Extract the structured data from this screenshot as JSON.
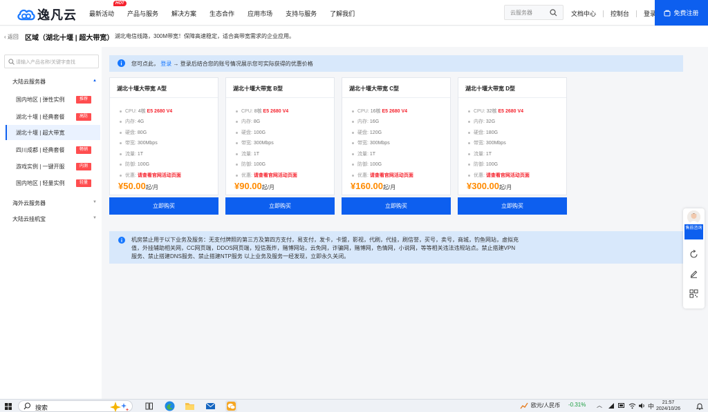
{
  "header": {
    "logo_text": "逸凡云",
    "nav": [
      {
        "label": "最新活动",
        "hot": "HOT"
      },
      {
        "label": "产品与服务"
      },
      {
        "label": "解决方案"
      },
      {
        "label": "生态合作"
      },
      {
        "label": "应用市场"
      },
      {
        "label": "支持与服务"
      },
      {
        "label": "了解我们"
      }
    ],
    "search_placeholder": "云服务器",
    "links": [
      "文档中心",
      "控制台",
      "登录"
    ],
    "register": "免费注册"
  },
  "crumb": {
    "back": "返回",
    "region": "区域（湖北十堰 | 超大带宽）",
    "desc": "湖北电信线路，300M带宽！保障高速稳定，适合高带宽需求的企业应用。"
  },
  "sidebar": {
    "search_placeholder": "请输入产品名称/关键字查找",
    "groups": [
      {
        "label": "大陆云服务器",
        "expanded": true
      },
      {
        "label": "海外云服务器",
        "expanded": false
      },
      {
        "label": "大陆云挂机宝",
        "expanded": false
      }
    ],
    "items": [
      {
        "label": "国内地区 | 弹性实例",
        "badge": "推荐"
      },
      {
        "label": "湖北十堰 | 经典套餐",
        "badge": "高防"
      },
      {
        "label": "湖北十堰 | 超大带宽",
        "badge": "",
        "active": true
      },
      {
        "label": "四川成都 | 经典套餐",
        "badge": "畅销"
      },
      {
        "label": "游戏实例 | 一键开服",
        "badge": "内测"
      },
      {
        "label": "国内地区 | 轻量实例",
        "badge": "轻量"
      }
    ]
  },
  "notice_top": {
    "prefix": "您可点此，",
    "link": "登录",
    "suffix": "→ 登录后结合您的账号情况展示您可实际获得的优惠价格"
  },
  "spec_labels": {
    "cpu": "CPU:",
    "mem": "内存:",
    "disk": "硬盘:",
    "bw": "带宽:",
    "traffic": "流量:",
    "ddos": "防御:",
    "promo": "优惠:"
  },
  "cards": [
    {
      "title": "湖北十堰大带宽 A型",
      "cpu_core": "4核",
      "cpu_model": "E5 2680 V4",
      "mem": "4G",
      "disk": "80G",
      "bw": "300Mbps",
      "traffic": "1T",
      "ddos": "100G",
      "promo": "请查看官网活动页面",
      "price": "¥50.00",
      "unit": "起/月",
      "buy": "立即购买"
    },
    {
      "title": "湖北十堰大带宽 B型",
      "cpu_core": "8核",
      "cpu_model": "E5 2680 V4",
      "mem": "8G",
      "disk": "100G",
      "bw": "300Mbps",
      "traffic": "1T",
      "ddos": "100G",
      "promo": "请查看官网活动页面",
      "price": "¥90.00",
      "unit": "起/月",
      "buy": "立即购买"
    },
    {
      "title": "湖北十堰大带宽 C型",
      "cpu_core": "16核",
      "cpu_model": "E5 2680 V4",
      "mem": "16G",
      "disk": "120G",
      "bw": "300Mbps",
      "traffic": "1T",
      "ddos": "100G",
      "promo": "请查看官网活动页面",
      "price": "¥160.00",
      "unit": "起/月",
      "buy": "立即购买"
    },
    {
      "title": "湖北十堰大带宽 D型",
      "cpu_core": "32核",
      "cpu_model": "E5 2680 V4",
      "mem": "32G",
      "disk": "180G",
      "bw": "300Mbps",
      "traffic": "1T",
      "ddos": "100G",
      "promo": "请查看官网活动页面",
      "price": "¥300.00",
      "unit": "起/月",
      "buy": "立即购买"
    }
  ],
  "notice_bottom": "机房禁止用于以下业务及服务：无支付牌照的第三方及第四方支付，易支付，发卡，卡盟，影视，代刷，代挂，刷信誉，买号，卖号，商城，钓鱼网站，虚拟充值，外挂辅助相关网，CC网页端，DDOS网页端，短信轰炸，赌博网站，云免网，诈骗网，赌博网，色情网，小说网，等等相关违法违规站点。禁止搭建VPN服务、禁止搭建DNS服务、禁止搭建NTP服务 以上业务及服务一经发现，立即永久关闭。",
  "float_panel": {
    "consult": "售前咨询"
  },
  "taskbar": {
    "search": "搜索",
    "currency": "欧元/人民币",
    "change": "-0.31%",
    "ime": "中",
    "time": "21:57",
    "date": "2024/10/26"
  },
  "colors": {
    "primary": "#0d5fef",
    "price": "#ff8a00",
    "badge": "#ff4d4f",
    "notice_bg": "#d8e8fb",
    "change": "#1a9e3f"
  }
}
